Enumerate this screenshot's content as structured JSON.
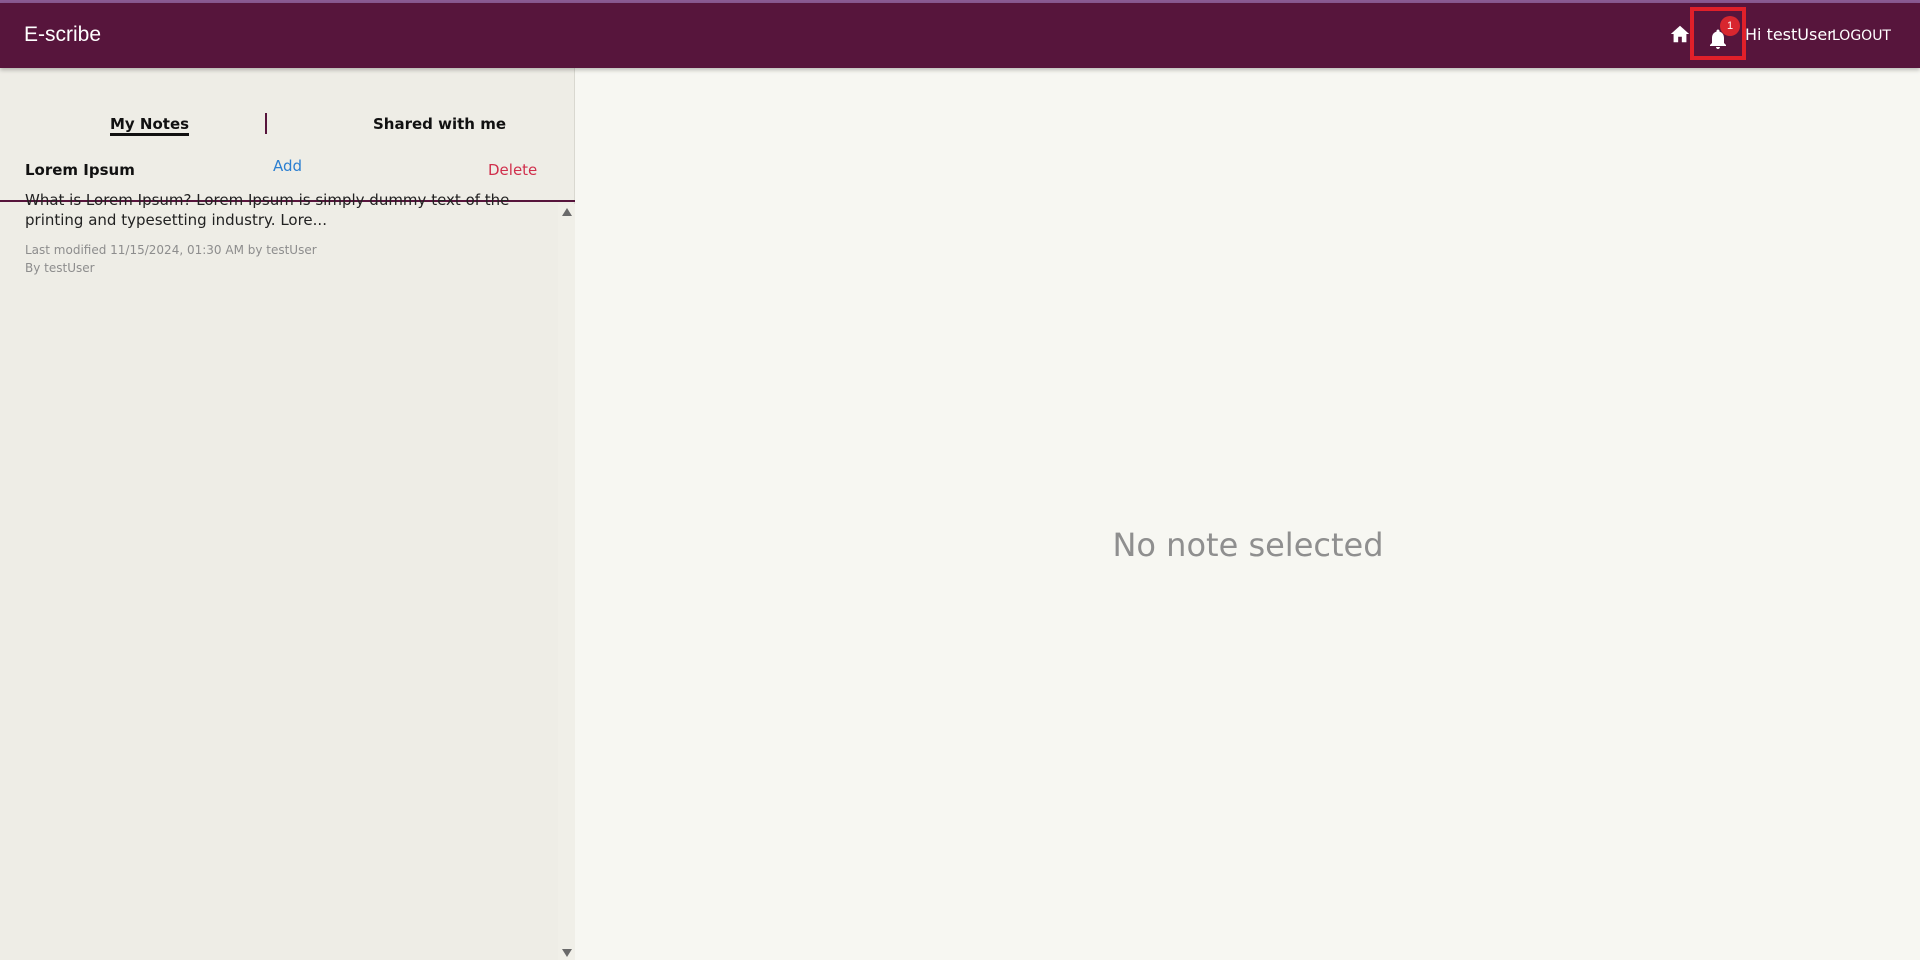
{
  "navbar": {
    "brand": "E-scribe",
    "notification_count": "1",
    "greeting": "Hi testUser",
    "logout_label": "LOGOUT",
    "icons": [
      "home-icon",
      "bell-icon"
    ],
    "colors": {
      "bar": "#57153c",
      "badge": "#d8262f",
      "highlight": "#e0202a"
    }
  },
  "sidebar": {
    "tabs": [
      {
        "label": "My Notes",
        "active": true
      },
      {
        "label": "Shared with me",
        "active": false
      }
    ],
    "add_label": "Add",
    "notes": [
      {
        "title": "Lorem Ipsum",
        "delete_label": "Delete",
        "snippet": "What is Lorem Ipsum? Lorem Ipsum is simply dummy text of the printing and typesetting industry. Lore...",
        "modified": "Last modified 11/15/2024, 01:30 AM by testUser",
        "author": "By testUser"
      }
    ]
  },
  "main": {
    "empty_message": "No note selected"
  }
}
